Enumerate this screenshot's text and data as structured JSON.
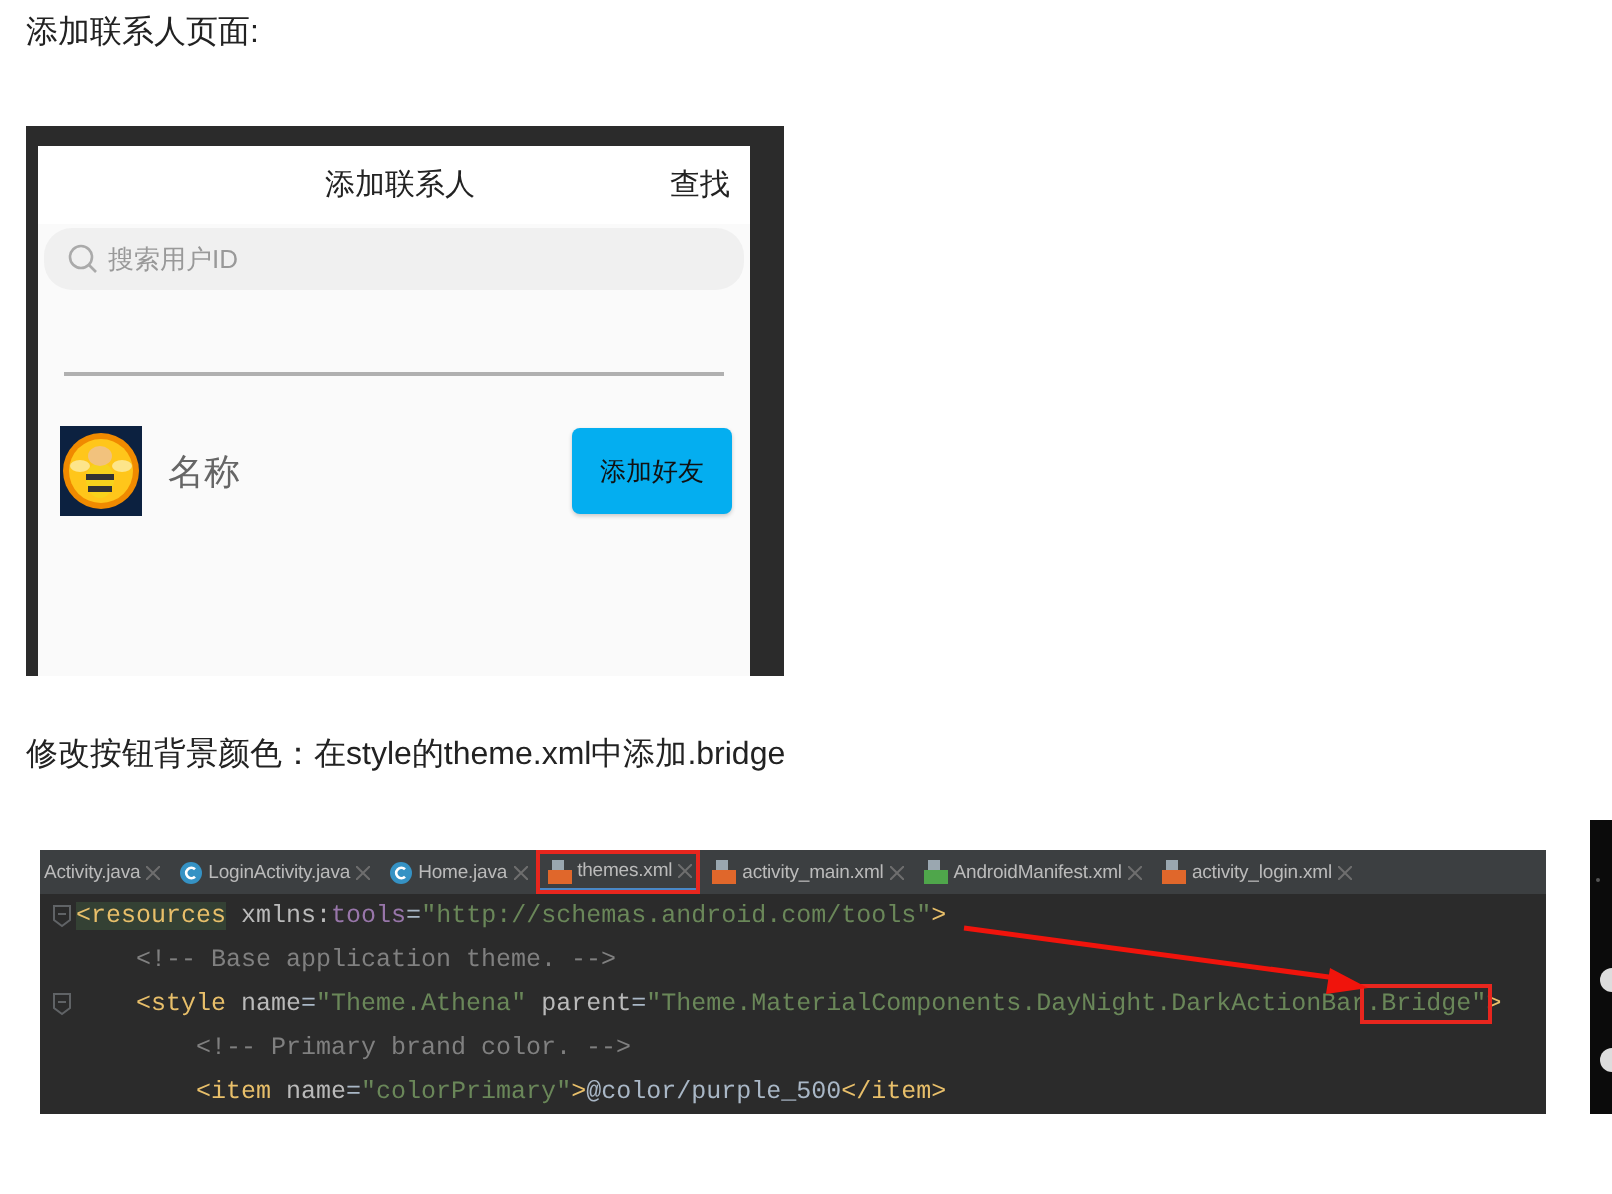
{
  "heading_1": "添加联系人页面:",
  "phone_screen": {
    "title": "添加联系人",
    "action": "查找",
    "search": {
      "placeholder": "搜索用户ID"
    },
    "contact": {
      "name": "名称",
      "button": "添加好友"
    }
  },
  "heading_2": "修改按钮背景颜色：在style的theme.xml中添加.bridge",
  "ide": {
    "tabs": [
      {
        "label": "Activity.java",
        "selected": false,
        "boxed": false
      },
      {
        "label": "LoginActivity.java",
        "kind": "java",
        "selected": false,
        "boxed": false
      },
      {
        "label": "Home.java",
        "kind": "java",
        "selected": false,
        "boxed": false
      },
      {
        "label": "themes.xml",
        "kind": "xml",
        "selected": true,
        "boxed": true
      },
      {
        "label": "activity_main.xml",
        "kind": "xml",
        "selected": false,
        "boxed": false
      },
      {
        "label": "AndroidManifest.xml",
        "kind": "manifest",
        "selected": false,
        "boxed": false
      },
      {
        "label": "activity_login.xml",
        "kind": "xml",
        "selected": false,
        "boxed": false
      }
    ],
    "code": [
      {
        "segments": [
          {
            "kind": "tag",
            "text": "<resources",
            "highlighted": true
          },
          {
            "kind": "attr",
            "text": " xmlns:"
          },
          {
            "kind": "ns",
            "text": "tools"
          },
          {
            "kind": "plain",
            "text": "="
          },
          {
            "kind": "value",
            "text": "\"http://schemas.android.com/tools\""
          },
          {
            "kind": "tag",
            "text": ">"
          }
        ],
        "children": [
          {
            "segments": [
              {
                "kind": "comment",
                "text": "<!-- Base application theme. -->"
              }
            ]
          },
          {
            "segments": [
              {
                "kind": "tag",
                "text": "<style"
              },
              {
                "kind": "attr",
                "text": " name"
              },
              {
                "kind": "plain",
                "text": "="
              },
              {
                "kind": "value",
                "text": "\"Theme.Athena\""
              },
              {
                "kind": "attr",
                "text": " parent"
              },
              {
                "kind": "plain",
                "text": "="
              },
              {
                "kind": "value",
                "text": "\"Theme.MaterialComponents.DayNight.DarkActionBar"
              },
              {
                "kind": "value",
                "text": ".Bridge\"",
                "boxed": true
              },
              {
                "kind": "tag",
                "text": ">"
              }
            ],
            "children": [
              {
                "segments": [
                  {
                    "kind": "comment",
                    "text": "<!-- Primary brand color. -->"
                  }
                ]
              },
              {
                "segments": [
                  {
                    "kind": "tag",
                    "text": "<item"
                  },
                  {
                    "kind": "attr",
                    "text": " name"
                  },
                  {
                    "kind": "plain",
                    "text": "="
                  },
                  {
                    "kind": "value",
                    "text": "\"colorPrimary\""
                  },
                  {
                    "kind": "tag",
                    "text": ">"
                  },
                  {
                    "kind": "plain",
                    "text": "@color/purple_500"
                  },
                  {
                    "kind": "tag",
                    "text": "</item>"
                  }
                ]
              }
            ]
          }
        ]
      }
    ]
  }
}
